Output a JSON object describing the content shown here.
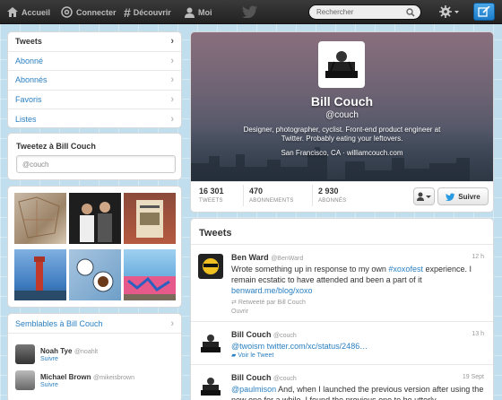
{
  "nav": {
    "home_label": "Accueil",
    "connect_label": "Connecter",
    "discover_label": "Découvrir",
    "me_label": "Moi",
    "search_placeholder": "Rechercher"
  },
  "sidebar": {
    "items": [
      {
        "label": "Tweets"
      },
      {
        "label": "Abonné"
      },
      {
        "label": "Abonnés"
      },
      {
        "label": "Favoris"
      },
      {
        "label": "Listes"
      }
    ]
  },
  "compose": {
    "title": "Tweetez à Bill Couch",
    "value": "@couch"
  },
  "similar": {
    "title": "Semblables à Bill Couch",
    "users": [
      {
        "name": "Noah Tye",
        "handle": "@noahlt",
        "action": "Suivre"
      },
      {
        "name": "Michael Brown",
        "handle": "@mikeisbrown",
        "action": "Suivre"
      }
    ]
  },
  "profile": {
    "name": "Bill Couch",
    "handle": "@couch",
    "bio_line1": "Designer, photographer, cyclist. Front-end product engineer at",
    "bio_line2": "Twitter. Probably eating your leftovers.",
    "location": "San Francisco, CA · williamcouch.com",
    "stats": [
      {
        "value": "16 301",
        "label": "TWEETS"
      },
      {
        "value": "470",
        "label": "ABONNEMENTS"
      },
      {
        "value": "2 930",
        "label": "ABONNÉS"
      }
    ],
    "follow_label": "Suivre"
  },
  "tweets": {
    "title": "Tweets",
    "items": [
      {
        "name": "Ben Ward",
        "handle": "@BenWard",
        "time": "12 h",
        "text_before": "Wrote something up in response to my own ",
        "hashtag": "#xoxofest",
        "text_after": " experience. I remain ecstatic to have attended and been a part of it",
        "link": "benward.me/blog/xoxo",
        "retweeted": "Retweeté par Bill Couch",
        "action": "Ouvrir"
      },
      {
        "name": "Bill Couch",
        "handle": "@couch",
        "time": "13 h",
        "mention": "@twoism",
        "link": "twitter.com/xc/status/2486…",
        "action": "Voir le Tweet"
      },
      {
        "name": "Bill Couch",
        "handle": "@couch",
        "time": "19 Sept",
        "mention": "@paulmison",
        "text_after": " And, when I launched the previous version after using the new one for a while, I found the previous one to be utterly"
      }
    ]
  },
  "colors": {
    "link": "#2a7fc0",
    "topbar": "#222222",
    "background": "#c0deed"
  }
}
